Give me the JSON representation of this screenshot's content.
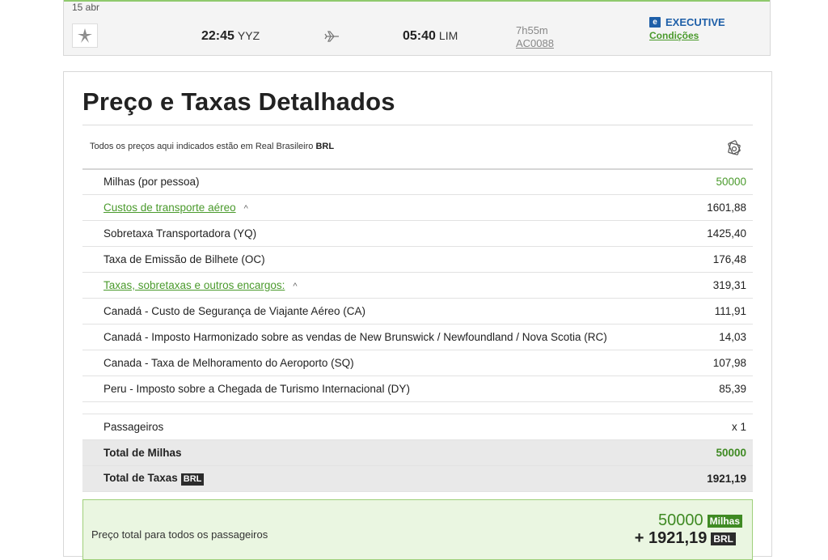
{
  "flight": {
    "date": "15 abr",
    "departure_time": "22:45",
    "departure_code": "YYZ",
    "arrival_time": "05:40",
    "arrival_code": "LIM",
    "duration": "7h55m",
    "flight_number": "AC0088",
    "cabin_badge": "e",
    "cabin": "EXECUTIVE",
    "conditions_link": "Condições"
  },
  "breakdown": {
    "title": "Preço e Taxas Detalhados",
    "currency_note_prefix": "Todos os preços aqui indicados estão em Real Brasileiro",
    "currency_code": "BRL",
    "rows": [
      {
        "label": "Milhas (por pessoa)",
        "value": "50000"
      },
      {
        "label": "Custos de transporte aéreo",
        "value": "1601,88",
        "caret": "^"
      },
      {
        "label": "Sobretaxa Transportadora (YQ)",
        "value": "1425,40"
      },
      {
        "label": "Taxa de Emissão de Bilhete (OC)",
        "value": "176,48"
      },
      {
        "label": "Taxas, sobretaxas e outros encargos:",
        "value": "319,31",
        "caret": "^"
      },
      {
        "label": "Canadá - Custo de Segurança de Viajante Aéreo (CA)",
        "value": "111,91"
      },
      {
        "label": "Canadá - Imposto Harmonizado sobre as vendas de New Brunswick / Newfoundland / Nova Scotia (RC)",
        "value": "14,03"
      },
      {
        "label": "Canada - Taxa de Melhoramento do Aeroporto (SQ)",
        "value": "107,98"
      },
      {
        "label": "Peru - Imposto sobre a Chegada de Turismo Internacional (DY)",
        "value": "85,39"
      }
    ],
    "passengers_label": "Passageiros",
    "passengers_value": "x 1",
    "total_miles_label": "Total de Milhas",
    "total_miles_value": "50000",
    "total_taxes_label": "Total de Taxas",
    "total_taxes_tag": "BRL",
    "total_taxes_value": "1921,19"
  },
  "total": {
    "label": "Preço total para todos os passageiros",
    "miles": "50000",
    "miles_tag": "Milhas",
    "taxes": "+ 1921,19",
    "taxes_tag": "BRL"
  },
  "colors": {
    "accent_green": "#4a9a2c",
    "cabin_blue": "#1e5fa8",
    "total_box_bg": "#eaf6e1"
  }
}
